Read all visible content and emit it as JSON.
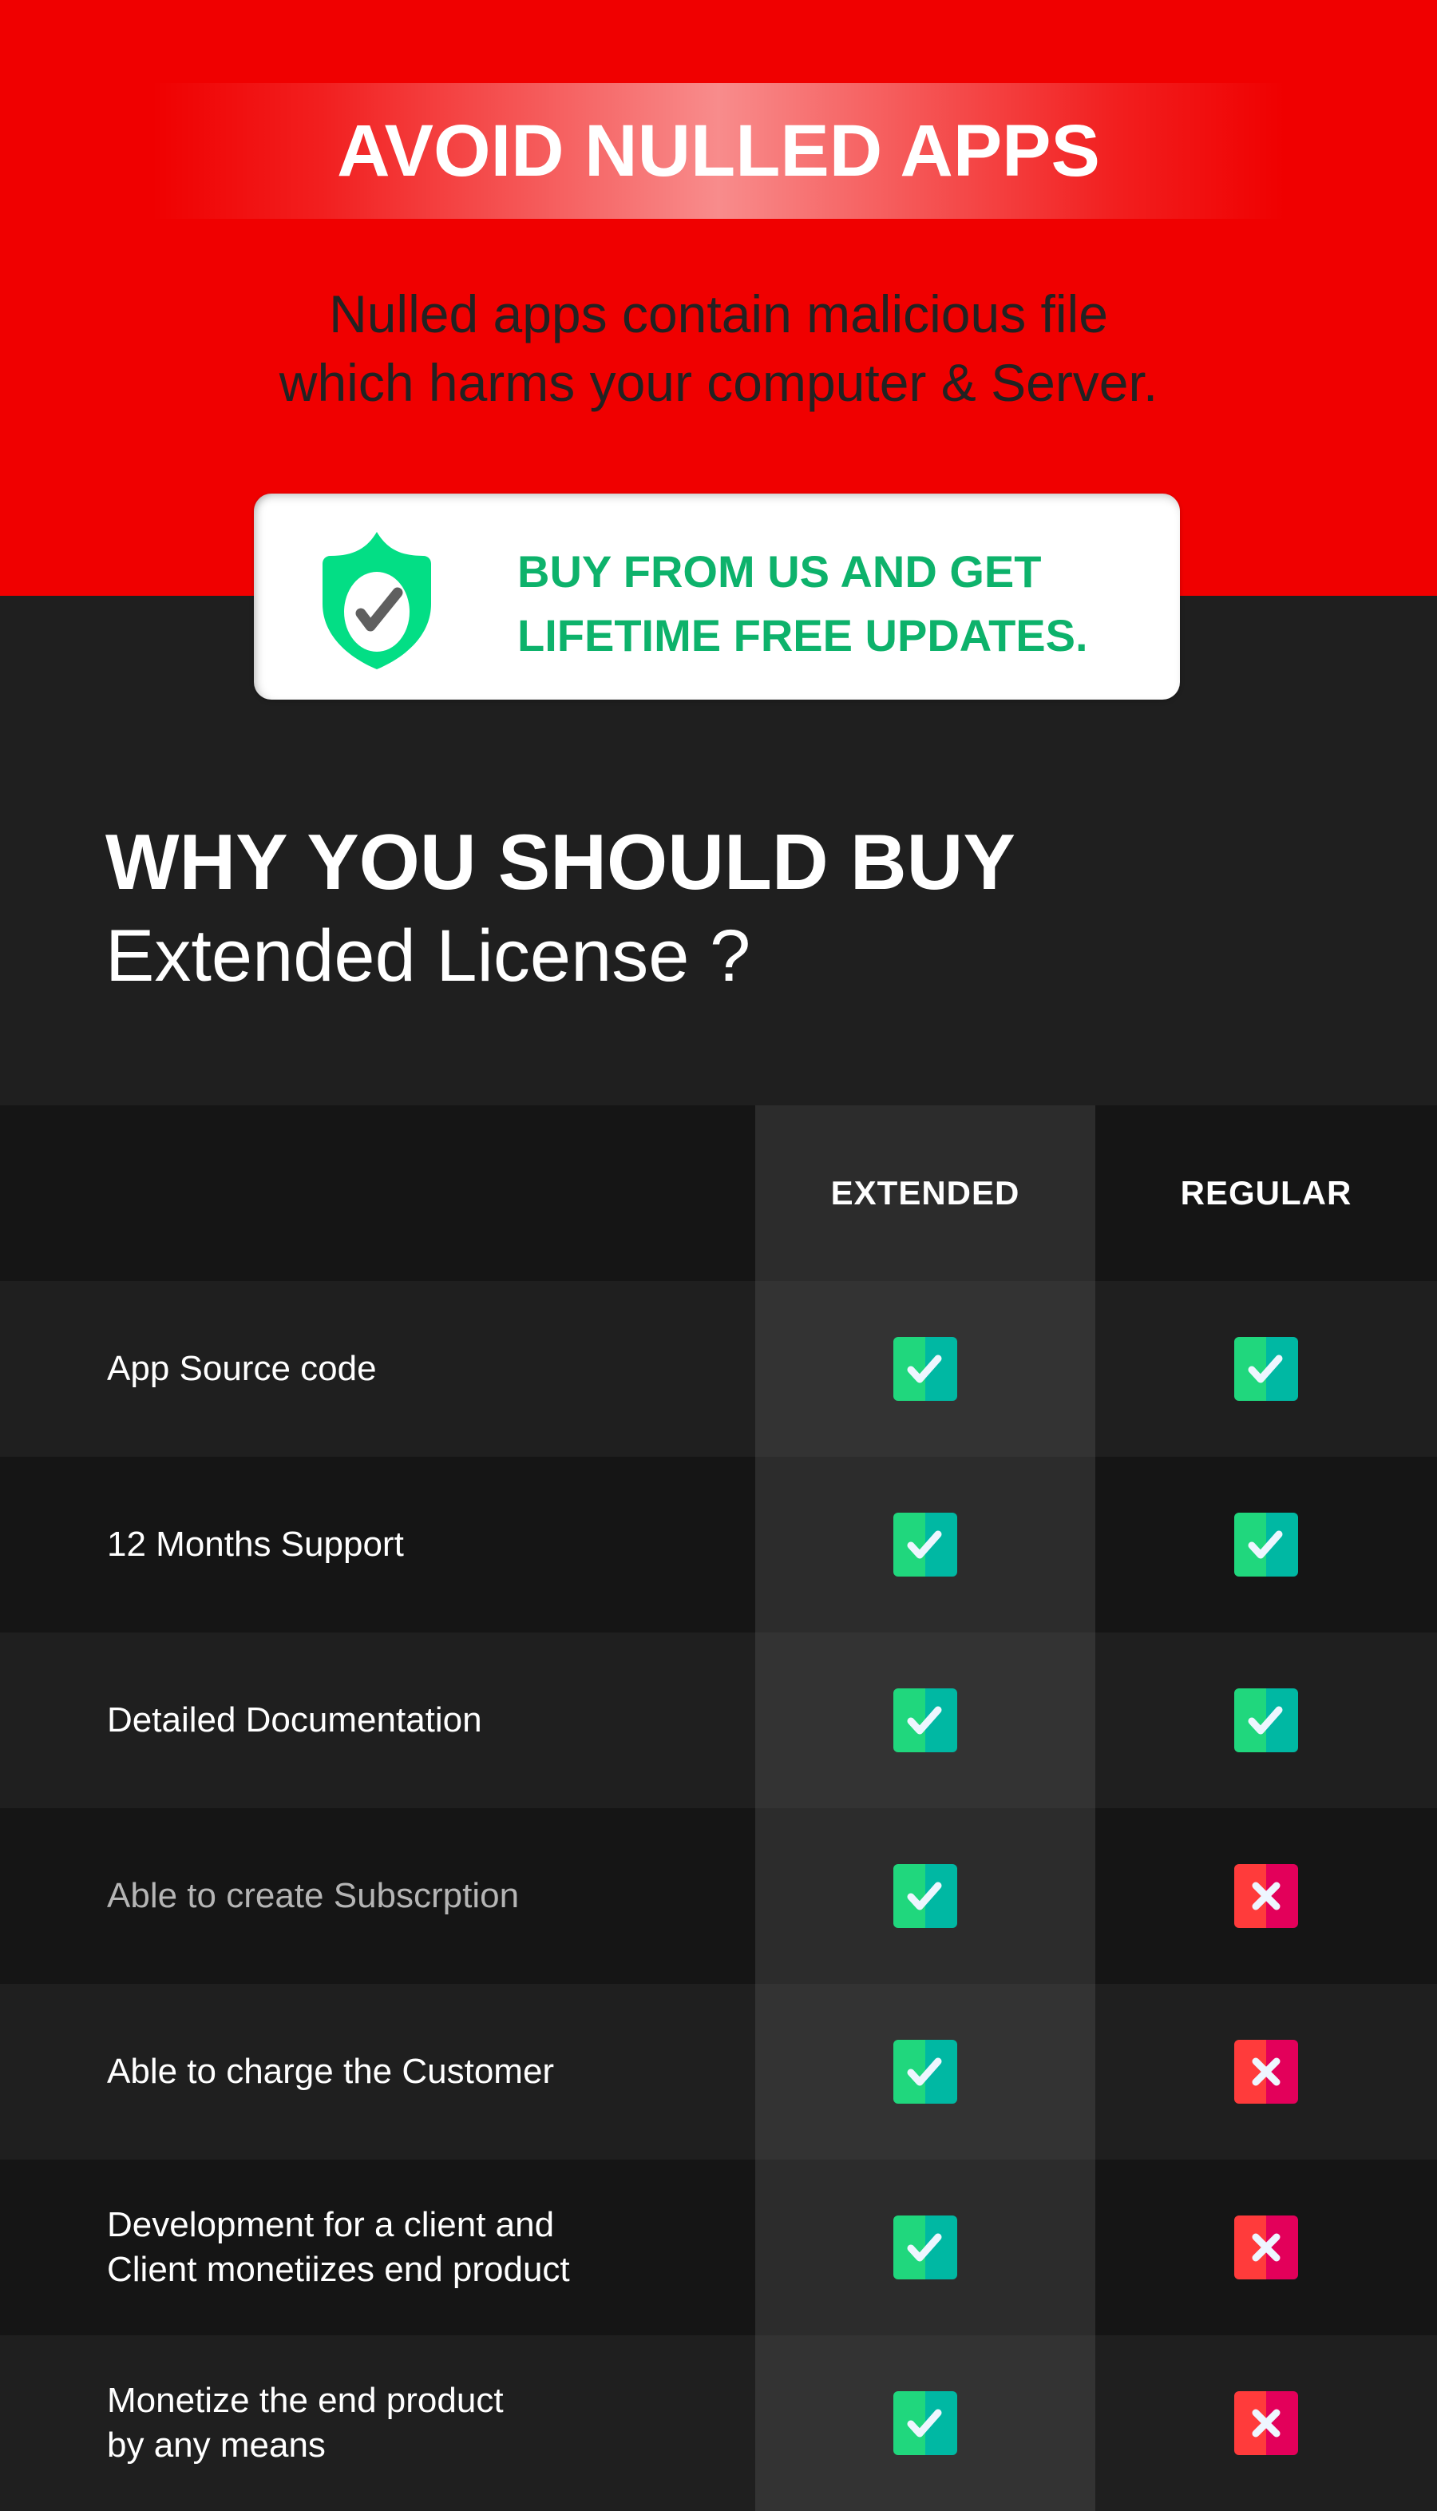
{
  "hero": {
    "banner_title": "AVOID NULLED APPS",
    "subtitle_line1": "Nulled apps contain malicious file",
    "subtitle_line2": "which harms your computer & Server.",
    "background_color": "#f00000"
  },
  "promo": {
    "icon": "shield-check-icon",
    "line1": "BUY FROM US AND GET",
    "line2": "LIFETIME FREE UPDATES.",
    "text_color": "#0db26b",
    "icon_color": "#03de85"
  },
  "why": {
    "title": "WHY YOU SHOULD BUY",
    "subtitle": "Extended License ?"
  },
  "comparison": {
    "columns": [
      "EXTENDED",
      "REGULAR"
    ],
    "rows": [
      {
        "feature_line1": "App Source code",
        "feature_line2": "",
        "extended": true,
        "regular": true,
        "muted": false
      },
      {
        "feature_line1": "12 Months Support",
        "feature_line2": "",
        "extended": true,
        "regular": true,
        "muted": false
      },
      {
        "feature_line1": "Detailed Documentation",
        "feature_line2": "",
        "extended": true,
        "regular": true,
        "muted": false
      },
      {
        "feature_line1": "Able to create Subscrption",
        "feature_line2": "",
        "extended": true,
        "regular": false,
        "muted": true
      },
      {
        "feature_line1": "Able to charge the Customer",
        "feature_line2": "",
        "extended": true,
        "regular": false,
        "muted": false
      },
      {
        "feature_line1": "Development for a client and",
        "feature_line2": "Client monetiizes end product",
        "extended": true,
        "regular": false,
        "muted": false
      },
      {
        "feature_line1": "Monetize the end product",
        "feature_line2": "by any means",
        "extended": true,
        "regular": false,
        "muted": false
      }
    ],
    "icons": {
      "yes": "check-box-icon",
      "no": "cross-box-icon"
    },
    "colors": {
      "check_left": "#20d77d",
      "check_right": "#00b8a3",
      "cross_left": "#ff3b3b",
      "cross_right": "#e3005a",
      "glyph": "#eef6ff"
    }
  }
}
